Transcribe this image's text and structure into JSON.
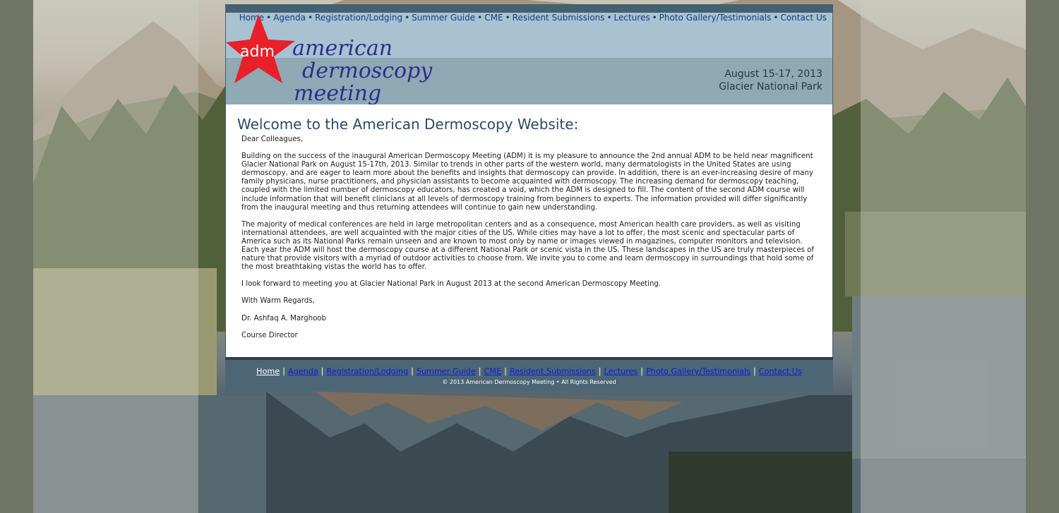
{
  "brand": {
    "logo_badge": "adm",
    "logo_line1": "american",
    "logo_line2": "dermoscopy",
    "logo_line3": "meeting"
  },
  "event": {
    "dates": "August 15-17, 2013",
    "location": "Glacier National Park"
  },
  "top_nav": [
    {
      "label": "Home"
    },
    {
      "label": "Agenda"
    },
    {
      "label": "Registration/Lodging"
    },
    {
      "label": "Summer Guide"
    },
    {
      "label": "CME"
    },
    {
      "label": "Resident Submissions"
    },
    {
      "label": "Lectures"
    },
    {
      "label": "Photo Gallery/Testimonials"
    },
    {
      "label": "Contact Us"
    }
  ],
  "main": {
    "title": "Welcome to the American Dermoscopy Website:",
    "salutation": "Dear Colleagues,",
    "paragraph1": "Building on the success of the inaugural American Dermoscopy Meeting (ADM) it is my pleasure to announce the 2nd annual ADM to be held near magnificent Glacier National Park on August 15-17th, 2013. Similar to trends in other parts of the western world, many dermatologists in the United States are using dermoscopy, and are eager to learn more about the benefits and insights that dermoscopy can provide. In addition, there is an ever-increasing desire of many family physicians, nurse practitioners, and physician assistants to become acquainted with dermoscopy. The increasing demand for dermoscopy teaching, coupled with the limited number of dermoscopy educators, has created a void, which the ADM is designed to fill. The content of the second ADM course will include information that will benefit clinicians at all levels of dermoscopy training from beginners to experts. The information provided will differ significantly from the inaugural meeting and thus returning attendees will continue to gain new understanding.",
    "paragraph2": "The majority of medical conferences are held in large metropolitan centers and as a consequence, most American health care providers, as well as visiting international attendees, are well acquainted with the major cities of the US. While cities may have a lot to offer, the most scenic and spectacular parts of America such as its National Parks remain unseen and are known to most only by name or images viewed in magazines, computer monitors and television. Each year the ADM will host the dermoscopy course at a different National Park or scenic vista in the US. These landscapes in the US are truly masterpieces of nature that provide visitors with a myriad of outdoor activities to choose from. We invite you to come and learn dermoscopy in surroundings that hold some of the most breathtaking vistas the world has to offer.",
    "paragraph3": "I look forward to meeting you at Glacier National Park in August 2013 at the second American Dermoscopy Meeting.",
    "closing": "With Warm Regards,",
    "signature_name": "Dr. Ashfaq A. Marghoob",
    "signature_title": "Course Director"
  },
  "footer": {
    "nav": [
      {
        "label": "Home"
      },
      {
        "label": "Agenda"
      },
      {
        "label": "Registration/Lodging"
      },
      {
        "label": "Summer Guide"
      },
      {
        "label": "CME"
      },
      {
        "label": "Resident Submissions"
      },
      {
        "label": "Lectures"
      },
      {
        "label": "Photo Gallery/Testimonials"
      },
      {
        "label": "Contact Us"
      }
    ],
    "copyright": "© 2013 American Dermoscopy Meeting • All Rights Reserved"
  },
  "colors": {
    "header_light": "#a9c2d2",
    "header_dark": "#8fa9b5",
    "frame": "#43616f",
    "footer": "#4d6676",
    "logo_star": "#e8202a",
    "logo_text": "#2b2f8c",
    "nav_link": "#173b80",
    "footer_link": "#0d1fd8"
  }
}
